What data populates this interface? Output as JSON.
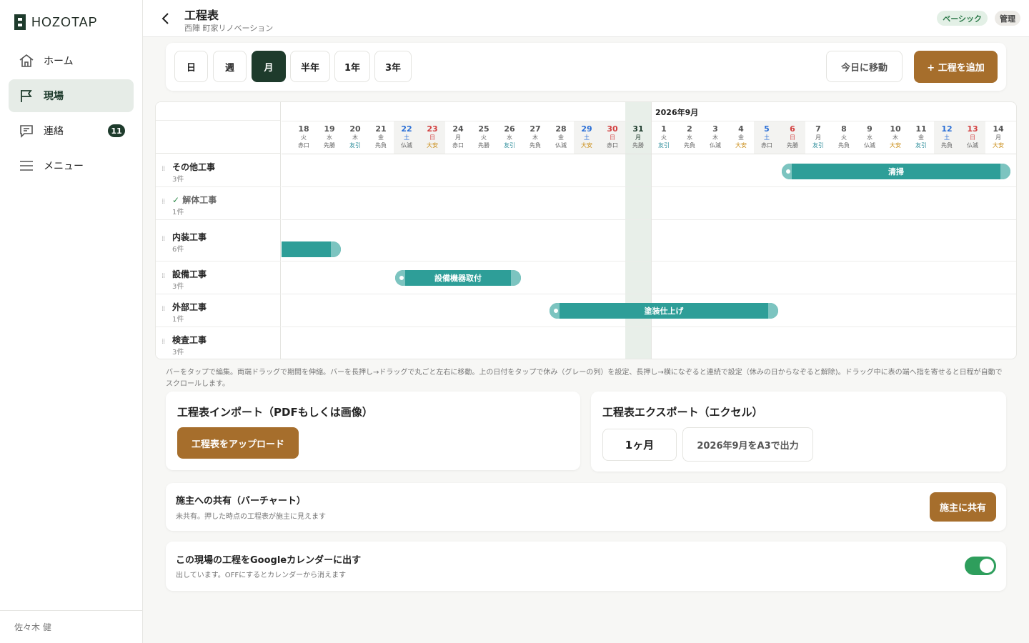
{
  "app": {
    "brand": "HOZOTAP"
  },
  "sidebar": {
    "items": [
      {
        "label": "ホーム",
        "icon": "home-icon"
      },
      {
        "label": "現場",
        "icon": "flag-icon",
        "active": true
      },
      {
        "label": "連絡",
        "icon": "message-icon",
        "badge": "11"
      },
      {
        "label": "メニュー",
        "icon": "menu-icon"
      }
    ],
    "user": "佐々木 健"
  },
  "header": {
    "title": "工程表",
    "subtitle": "西陣 町家リノベーション",
    "plan_badge": "ベーシック",
    "role_badge": "管理"
  },
  "toolbar": {
    "ranges": [
      "日",
      "週",
      "月",
      "半年",
      "1年",
      "3年"
    ],
    "active_range": "月",
    "today_label": "今日に移動",
    "add_label": "+ 工程を追加"
  },
  "gantt": {
    "month_label": "2026年9月",
    "days": [
      {
        "d": "18",
        "w": "火",
        "r": "赤口",
        "type": ""
      },
      {
        "d": "19",
        "w": "水",
        "r": "先勝",
        "type": ""
      },
      {
        "d": "20",
        "w": "木",
        "r": "友引",
        "type": "",
        "rc": "blue"
      },
      {
        "d": "21",
        "w": "金",
        "r": "先負",
        "type": ""
      },
      {
        "d": "22",
        "w": "土",
        "r": "仏滅",
        "type": "sat"
      },
      {
        "d": "23",
        "w": "日",
        "r": "大安",
        "type": "sun",
        "rc": "gold"
      },
      {
        "d": "24",
        "w": "月",
        "r": "赤口",
        "type": ""
      },
      {
        "d": "25",
        "w": "火",
        "r": "先勝",
        "type": ""
      },
      {
        "d": "26",
        "w": "水",
        "r": "友引",
        "type": "",
        "rc": "blue"
      },
      {
        "d": "27",
        "w": "木",
        "r": "先負",
        "type": ""
      },
      {
        "d": "28",
        "w": "金",
        "r": "仏滅",
        "type": ""
      },
      {
        "d": "29",
        "w": "土",
        "r": "大安",
        "type": "sat",
        "rc": "gold"
      },
      {
        "d": "30",
        "w": "日",
        "r": "赤口",
        "type": "sun"
      },
      {
        "d": "31",
        "w": "月",
        "r": "先勝",
        "type": "today"
      },
      {
        "d": "1",
        "w": "火",
        "r": "友引",
        "type": "",
        "rc": "blue"
      },
      {
        "d": "2",
        "w": "水",
        "r": "先負",
        "type": ""
      },
      {
        "d": "3",
        "w": "木",
        "r": "仏滅",
        "type": ""
      },
      {
        "d": "4",
        "w": "金",
        "r": "大安",
        "type": "",
        "rc": "gold"
      },
      {
        "d": "5",
        "w": "土",
        "r": "赤口",
        "type": "sat"
      },
      {
        "d": "6",
        "w": "日",
        "r": "先勝",
        "type": "sun"
      },
      {
        "d": "7",
        "w": "月",
        "r": "友引",
        "type": "",
        "rc": "blue"
      },
      {
        "d": "8",
        "w": "火",
        "r": "先負",
        "type": ""
      },
      {
        "d": "9",
        "w": "水",
        "r": "仏滅",
        "type": ""
      },
      {
        "d": "10",
        "w": "木",
        "r": "大安",
        "type": "",
        "rc": "gold"
      },
      {
        "d": "11",
        "w": "金",
        "r": "友引",
        "type": "",
        "rc": "blue"
      },
      {
        "d": "12",
        "w": "土",
        "r": "先負",
        "type": "sat"
      },
      {
        "d": "13",
        "w": "日",
        "r": "仏滅",
        "type": "sun"
      },
      {
        "d": "14",
        "w": "月",
        "r": "大安",
        "type": "",
        "rc": "gold"
      }
    ],
    "rows": [
      {
        "name": "その他工事",
        "count": "3件"
      },
      {
        "name": "解体工事",
        "count": "1件",
        "done": true
      },
      {
        "name": "内装工事",
        "count": "6件"
      },
      {
        "name": "設備工事",
        "count": "3件"
      },
      {
        "name": "外部工事",
        "count": "1件"
      },
      {
        "name": "検査工事",
        "count": "3件"
      }
    ],
    "bars": [
      {
        "row": 0,
        "label": "清掃",
        "start": "9/5",
        "end": "9/14"
      },
      {
        "row": 2,
        "label": "",
        "start": "",
        "end": "9/19"
      },
      {
        "row": 3,
        "label": "設備機器取付",
        "start": "9/22",
        "end": "9/26"
      },
      {
        "row": 4,
        "label": "塗装仕上げ",
        "start": "9/28",
        "end": "9/6"
      }
    ]
  },
  "hint": "バーをタップで編集。両端ドラッグで期間を伸縮。バーを長押し→ドラッグで丸ごと左右に移動。上の日付をタップで休み（グレーの列）を設定、長押し→横になぞると連続で設定（休みの日からなぞると解除)。ドラッグ中に表の端へ指を寄せると日程が自動でスクロールします。",
  "import": {
    "title": "工程表インポート（PDFもしくは画像）",
    "button": "工程表をアップロード"
  },
  "export": {
    "title": "工程表エクスポート（エクセル）",
    "period": "1ヶ月",
    "button": "2026年9月をA3で出力"
  },
  "share": {
    "title": "施主への共有（バーチャート）",
    "desc": "未共有。押した時点の工程表が施主に見えます",
    "button": "施主に共有"
  },
  "gcal": {
    "title": "この現場の工程をGoogleカレンダーに出す",
    "desc": "出しています。OFFにするとカレンダーから消えます",
    "enabled": true
  },
  "colors": {
    "brand": "#1e3b2c",
    "accent": "#a66e2c",
    "bar": "#2e9e98"
  }
}
